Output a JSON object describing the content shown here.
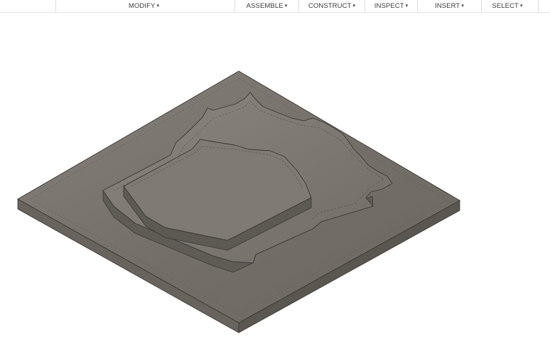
{
  "toolbar": {
    "items": [
      {
        "label": "MODIFY"
      },
      {
        "label": "ASSEMBLE"
      },
      {
        "label": "CONSTRUCT"
      },
      {
        "label": "INSPECT"
      },
      {
        "label": "INSERT"
      },
      {
        "label": "SELECT"
      }
    ],
    "caret": "▾"
  },
  "colors": {
    "model_top": "#7a756e",
    "model_side_left": "#6a665f",
    "model_side_right": "#5c5852",
    "edge": "#3a3734",
    "toolbar_text": "#3c3c3c"
  }
}
